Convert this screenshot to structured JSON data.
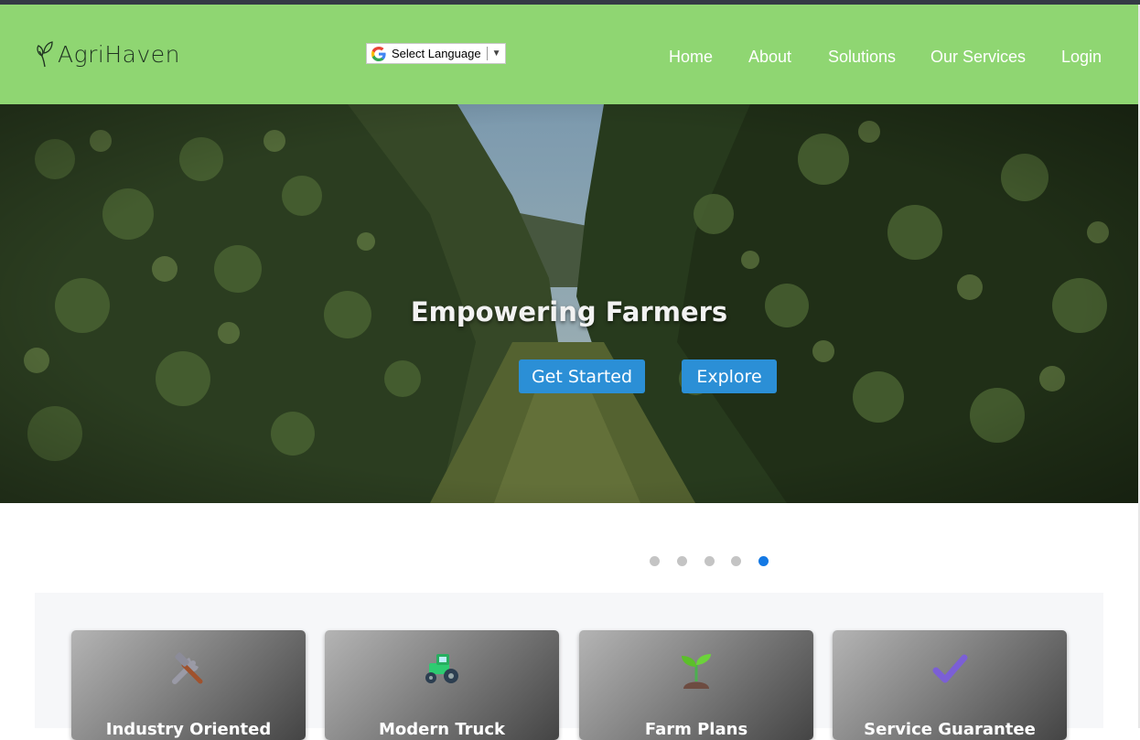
{
  "header": {
    "logo_text": "AgriHaven",
    "language_select": "Select Language",
    "nav": [
      "Home",
      "About",
      "Solutions",
      "Our Services",
      "Login"
    ]
  },
  "hero": {
    "title": "Empowering Farmers",
    "buttons": [
      "Get Started",
      "Explore"
    ]
  },
  "carousel": {
    "slides": 5,
    "active": 5
  },
  "features": [
    {
      "title": "Industry Oriented",
      "icon": "hammer-and-wrench-icon"
    },
    {
      "title": "Modern Truck",
      "icon": "tractor-icon"
    },
    {
      "title": "Farm Plans",
      "icon": "seedling-icon"
    },
    {
      "title": "Service Guarantee",
      "icon": "check-mark-icon"
    }
  ],
  "colors": {
    "navbar": "#8fd672",
    "button": "#2b8fd6",
    "dot_active": "#1479e4"
  }
}
